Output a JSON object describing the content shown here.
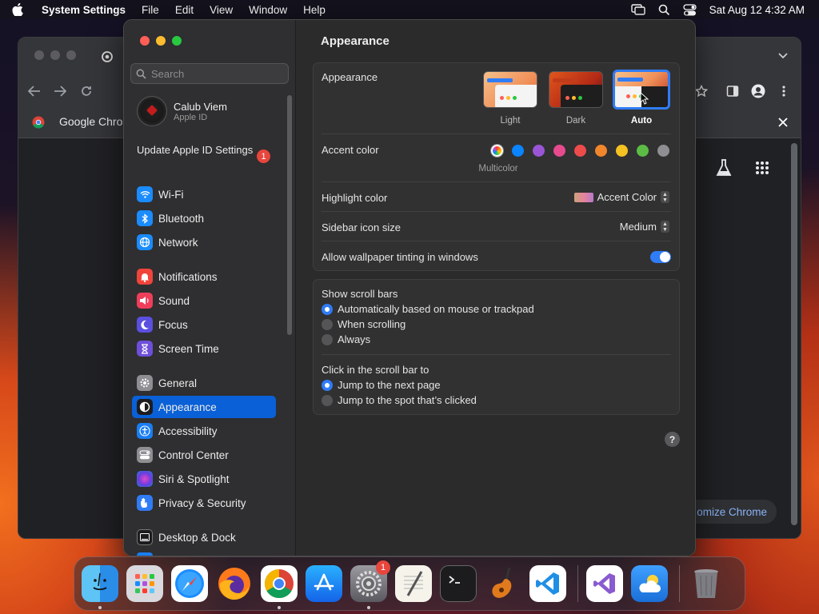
{
  "menubar": {
    "app_name": "System Settings",
    "menus": [
      "File",
      "Edit",
      "View",
      "Window",
      "Help"
    ],
    "datetime": "Sat Aug 12  4:32 AM"
  },
  "chrome": {
    "bookmark": "Google Chrom",
    "customize_label": "omize Chrome"
  },
  "sidebar": {
    "search_placeholder": "Search",
    "profile": {
      "name": "Calub Viem",
      "sub": "Apple ID"
    },
    "update": {
      "label": "Update Apple ID Settings",
      "badge": "1"
    },
    "items": [
      {
        "label": "Wi-Fi",
        "icon": "wifi-icon",
        "color": "#1a8cff"
      },
      {
        "label": "Bluetooth",
        "icon": "bluetooth-icon",
        "color": "#1a8cff"
      },
      {
        "label": "Network",
        "icon": "globe-icon",
        "color": "#1a8cff"
      },
      {
        "label": "Notifications",
        "icon": "bell-icon",
        "color": "#f0443a"
      },
      {
        "label": "Sound",
        "icon": "speaker-icon",
        "color": "#ef3e5a"
      },
      {
        "label": "Focus",
        "icon": "moon-icon",
        "color": "#5b4fe0"
      },
      {
        "label": "Screen Time",
        "icon": "hourglass-icon",
        "color": "#6d4fd9"
      },
      {
        "label": "General",
        "icon": "gear-icon",
        "color": "#8e8e93"
      },
      {
        "label": "Appearance",
        "icon": "appearance-icon",
        "color": "#1c1c1e"
      },
      {
        "label": "Accessibility",
        "icon": "accessibility-icon",
        "color": "#1a7ef2"
      },
      {
        "label": "Control Center",
        "icon": "control-center-icon",
        "color": "#8e8e93"
      },
      {
        "label": "Siri & Spotlight",
        "icon": "siri-icon",
        "color": "#b04ad0"
      },
      {
        "label": "Privacy & Security",
        "icon": "hand-icon",
        "color": "#2f7cf6"
      },
      {
        "label": "Desktop & Dock",
        "icon": "dock-icon",
        "color": "#1c1c1e"
      }
    ],
    "active": "Appearance"
  },
  "main": {
    "title": "Appearance",
    "appearance": {
      "label": "Appearance",
      "options": [
        "Light",
        "Dark",
        "Auto"
      ],
      "selected": "Auto"
    },
    "accent": {
      "label": "Accent color",
      "colors": [
        "multicolor",
        "#0a84ff",
        "#9a55d6",
        "#e84a8e",
        "#ee4b4b",
        "#f2862b",
        "#f6c221",
        "#5bbd45",
        "#8e8e93"
      ],
      "selected_caption": "Multicolor"
    },
    "highlight": {
      "label": "Highlight color",
      "value": "Accent Color"
    },
    "sidebar_icon": {
      "label": "Sidebar icon size",
      "value": "Medium"
    },
    "tinting": {
      "label": "Allow wallpaper tinting in windows",
      "on": true
    },
    "scroll": {
      "label": "Show scroll bars",
      "options": [
        "Automatically based on mouse or trackpad",
        "When scrolling",
        "Always"
      ],
      "selected": 0
    },
    "click": {
      "label": "Click in the scroll bar to",
      "options": [
        "Jump to the next page",
        "Jump to the spot that’s clicked"
      ],
      "selected": 0
    },
    "help": "?"
  },
  "dock": {
    "apps": [
      "finder",
      "launchpad",
      "safari",
      "firefox",
      "chrome",
      "app-store",
      "system-settings",
      "textedit",
      "terminal",
      "garageband",
      "vscode",
      "visual-studio",
      "weather",
      "trash"
    ],
    "settings_badge": "1"
  }
}
